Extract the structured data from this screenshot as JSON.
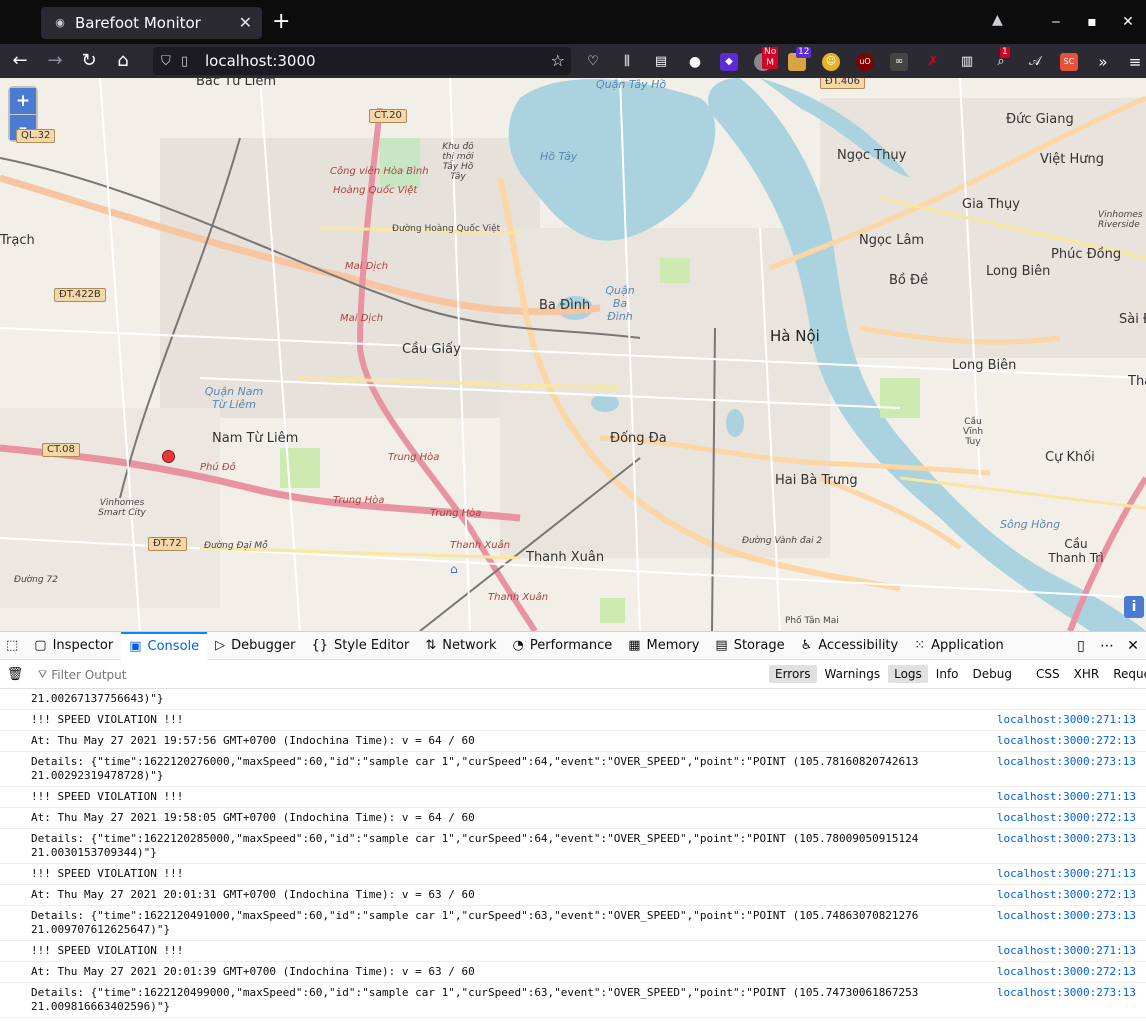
{
  "browser": {
    "tab_title": "Barefoot Monitor",
    "url": "localhost:3000",
    "ext_badges": {
      "noscript": "No M",
      "count12": "12",
      "count1": "1"
    }
  },
  "map": {
    "labels": {
      "bac_tu_liem": "Bắc Từ Liêm",
      "ct20": "CT.20",
      "ct08": "CT.08",
      "dt406": "ĐT.406",
      "dt422b": "ĐT.422B",
      "dt72": "ĐT.72",
      "ql32": "QL.32",
      "quan_tay_ho": "Quận Tây Hồ",
      "ho_tay": "Hồ Tây",
      "khu_do_thi": "Khu đô thị mới Tây Hồ Tây",
      "cong_vien": "Công viên Hòa Bình",
      "hoang_quoc_viet": "Hoàng Quốc Việt",
      "duong_hqv": "Đường Hoàng Quốc Việt",
      "mai_dich1": "Mai Dịch",
      "mai_dich2": "Mai Dịch",
      "ba_dinh": "Ba Đình",
      "quan_ba_dinh": "Quận Ba Đình",
      "cau_giay": "Cầu Giấy",
      "ha_noi": "Hà Nội",
      "nam_tu_liem": "Nam Từ Liêm",
      "quan_nam_tu_liem": "Quận Nam Từ Liêm",
      "phu_do": "Phú Đô",
      "vinhomes": "Vinhomes Smart City",
      "trung_hoa1": "Trung Hòa",
      "trung_hoa2": "Trung Hòa",
      "trung_hoa3": "Trung Hòa",
      "dong_da": "Đống Đa",
      "hai_ba_trung": "Hai Bà Trưng",
      "thanh_xuan": "Thanh Xuân",
      "thanh_xuan_red1": "Thanh Xuân",
      "thanh_xuan_red2": "Thanh Xuân",
      "duc_giang": "Đức Giang",
      "ngoc_thuy": "Ngọc Thụy",
      "viet_hung": "Việt Hưng",
      "gia_thuy": "Gia Thụy",
      "ngoc_lam": "Ngọc Lâm",
      "phuc_dong": "Phúc Đồng",
      "long_bien1": "Long Biên",
      "long_bien2": "Long Biên",
      "bo_de": "Bồ Đề",
      "sai_dong": "Sài Đ",
      "cau_vinh_tuy": "Cầu Vĩnh Tuy",
      "cu_khoi": "Cự Khối",
      "cau_thanh_tri": "Cầu Thanh Trì",
      "trach": "Trạch",
      "tha": "Thạ",
      "song_hong": "Sông Hồng",
      "vinhomes_riverside": "Vinhomes Riverside",
      "duong_vanh_dai2": "Đường Vành đai 2",
      "pho_tan_mai": "Phố Tân Mai",
      "duong_dai_mo": "Đường Đại Mỗ",
      "duong_72": "Đường 72"
    }
  },
  "devtools": {
    "tabs": [
      "Inspector",
      "Console",
      "Debugger",
      "Style Editor",
      "Network",
      "Performance",
      "Memory",
      "Storage",
      "Accessibility",
      "Application"
    ],
    "filter_placeholder": "Filter Output",
    "levels": [
      "Errors",
      "Warnings",
      "Logs",
      "Info",
      "Debug"
    ],
    "types": [
      "CSS",
      "XHR",
      "Requests"
    ],
    "rows": [
      {
        "text": "21.00267137756643)\"}",
        "src": ""
      },
      {
        "text": "!!! SPEED VIOLATION !!!",
        "src": "localhost:3000:271:13"
      },
      {
        "text": "At: Thu May 27 2021 19:57:56 GMT+0700 (Indochina Time): v = 64 / 60",
        "src": "localhost:3000:272:13"
      },
      {
        "text": "Details: {\"time\":1622120276000,\"maxSpeed\":60,\"id\":\"sample car 1\",\"curSpeed\":64,\"event\":\"OVER_SPEED\",\"point\":\"POINT (105.78160820742613 21.00292319478728)\"}",
        "src": "localhost:3000:273:13"
      },
      {
        "text": "!!! SPEED VIOLATION !!!",
        "src": "localhost:3000:271:13"
      },
      {
        "text": "At: Thu May 27 2021 19:58:05 GMT+0700 (Indochina Time): v = 64 / 60",
        "src": "localhost:3000:272:13"
      },
      {
        "text": "Details: {\"time\":1622120285000,\"maxSpeed\":60,\"id\":\"sample car 1\",\"curSpeed\":64,\"event\":\"OVER_SPEED\",\"point\":\"POINT (105.78009050915124 21.0030153709344)\"}",
        "src": "localhost:3000:273:13"
      },
      {
        "text": "!!! SPEED VIOLATION !!!",
        "src": "localhost:3000:271:13"
      },
      {
        "text": "At: Thu May 27 2021 20:01:31 GMT+0700 (Indochina Time): v = 63 / 60",
        "src": "localhost:3000:272:13"
      },
      {
        "text": "Details: {\"time\":1622120491000,\"maxSpeed\":60,\"id\":\"sample car 1\",\"curSpeed\":63,\"event\":\"OVER_SPEED\",\"point\":\"POINT (105.74863070821276 21.009707612625647)\"}",
        "src": "localhost:3000:273:13"
      },
      {
        "text": "!!! SPEED VIOLATION !!!",
        "src": "localhost:3000:271:13"
      },
      {
        "text": "At: Thu May 27 2021 20:01:39 GMT+0700 (Indochina Time): v = 63 / 60",
        "src": "localhost:3000:272:13"
      },
      {
        "text": "Details: {\"time\":1622120499000,\"maxSpeed\":60,\"id\":\"sample car 1\",\"curSpeed\":63,\"event\":\"OVER_SPEED\",\"point\":\"POINT (105.74730061867253 21.009816663402596)\"}",
        "src": "localhost:3000:273:13"
      }
    ]
  }
}
